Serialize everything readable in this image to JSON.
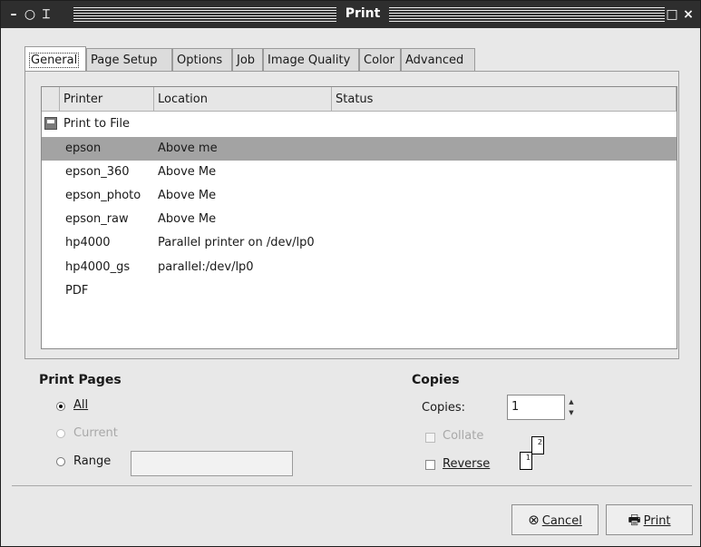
{
  "window": {
    "title": "Print",
    "controls": {
      "minimize": "–",
      "shade": "○",
      "pin": "⌶",
      "maximize": "□",
      "close": "×"
    }
  },
  "tabs": [
    {
      "label": "General",
      "active": true
    },
    {
      "label": "Page Setup",
      "active": false
    },
    {
      "label": "Options",
      "active": false
    },
    {
      "label": "Job",
      "active": false
    },
    {
      "label": "Image Quality",
      "active": false
    },
    {
      "label": "Color",
      "active": false
    },
    {
      "label": "Advanced",
      "active": false
    }
  ],
  "printer_list": {
    "columns": [
      "Printer",
      "Location",
      "Status"
    ],
    "rows": [
      {
        "printer": "Print to File",
        "location": "",
        "status": "",
        "icon": "floppy-disk-icon"
      },
      {
        "printer": "epson",
        "location": "Above me",
        "status": "",
        "selected": true
      },
      {
        "printer": "epson_360",
        "location": "Above Me",
        "status": ""
      },
      {
        "printer": "epson_photo",
        "location": "Above Me",
        "status": ""
      },
      {
        "printer": "epson_raw",
        "location": "Above Me",
        "status": ""
      },
      {
        "printer": "hp4000",
        "location": "Parallel printer on /dev/lp0",
        "status": ""
      },
      {
        "printer": "hp4000_gs",
        "location": "parallel:/dev/lp0",
        "status": ""
      },
      {
        "printer": "PDF",
        "location": "",
        "status": ""
      }
    ]
  },
  "print_pages": {
    "heading": "Print Pages",
    "all_label": "All",
    "current_label": "Current",
    "range_label": "Range",
    "range_value": "",
    "selected": "All"
  },
  "copies": {
    "heading": "Copies",
    "copies_label": "Copies:",
    "copies_value": "1",
    "collate_label": "Collate",
    "reverse_label": "Reverse",
    "page_icon_1": "1",
    "page_icon_2": "2"
  },
  "buttons": {
    "cancel_label": "Cancel",
    "print_label": "Print"
  }
}
